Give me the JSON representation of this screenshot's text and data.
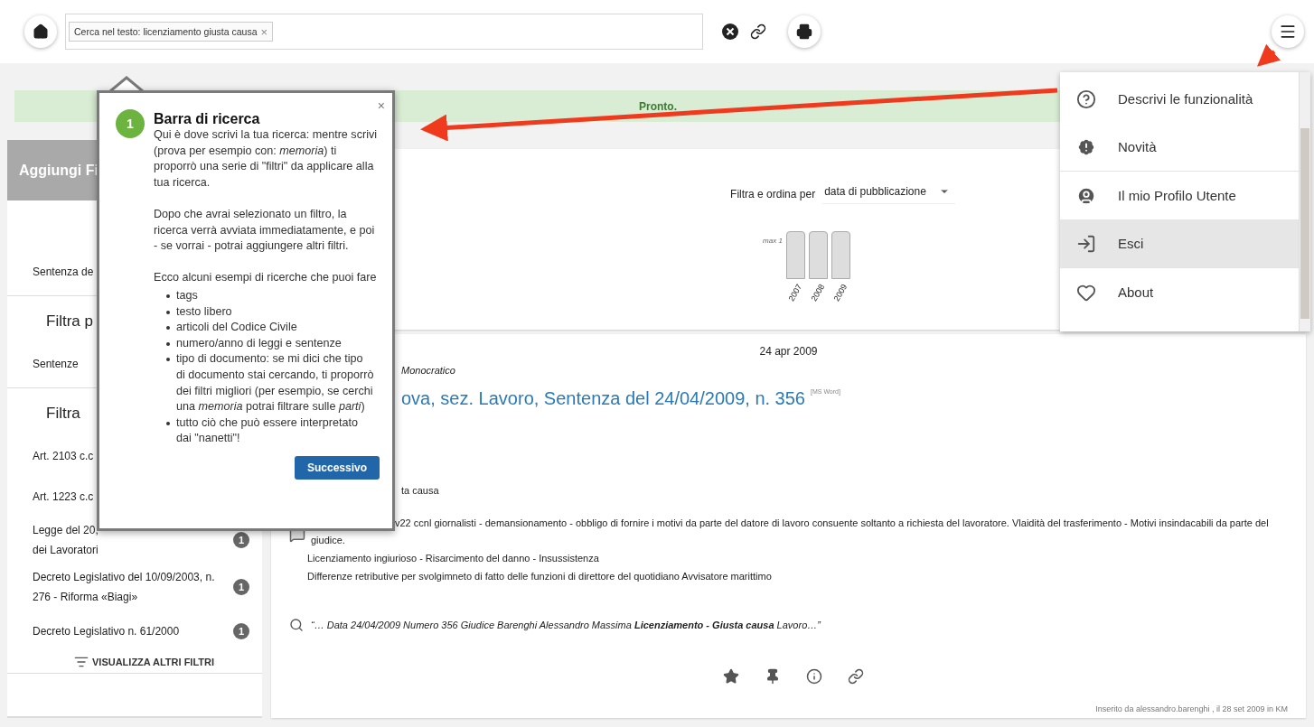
{
  "toolbar": {
    "search_chip": "Cerca nel testo: licenziamento giusta causa",
    "chip_remove": "×"
  },
  "status": {
    "text": "Pronto."
  },
  "sidebar": {
    "add_button": "Aggiungi Fi",
    "sections": [
      {
        "items": [
          {
            "lines": [
              "Sentenza de"
            ]
          }
        ]
      },
      {
        "heading": "Filtra p",
        "items": [
          {
            "lines": [
              "Sentenze"
            ]
          }
        ]
      },
      {
        "heading": "Filtra",
        "items": [
          {
            "lines": [
              "Art. 2103 c.c"
            ]
          },
          {
            "lines": [
              "Art. 1223 c.c"
            ]
          },
          {
            "lines": [
              "Legge del 20,",
              "dei Lavoratori"
            ],
            "count": "1"
          },
          {
            "lines": [
              "Decreto Legislativo del 10/09/2003, n. 276 - Riforma «Biagi»"
            ],
            "count": "1"
          },
          {
            "lines": [
              "Decreto Legislativo n. 61/2000"
            ],
            "count": "1"
          }
        ],
        "more": "VISUALIZZA ALTRI FILTRI"
      }
    ]
  },
  "filter": {
    "label": "Filtra e ordina per",
    "value": "data di pubblicazione"
  },
  "histogram": {
    "max_label": "max 1",
    "years": [
      "2007",
      "2008",
      "2009"
    ]
  },
  "result": {
    "date": "24 apr 2009",
    "court_fragment": "Monocratico",
    "title": "ova, sez. Lavoro, Sentenza del 24/04/2009, n. 356",
    "format": "[MS Word]",
    "tag_fragment": "ta causa",
    "summary_lines": [
      "v22 ccnl giornalisti - demansionamento - obbligo di fornire i motivi da parte del datore di lavoro consuente soltanto a richiesta del lavoratore. Vlaidità del trasferimento - Motivi insindacabili da parte del",
      "giudice."
    ],
    "notes": [
      "Licenziamento ingiurioso - Risarcimento del danno - Insussistenza",
      "Differenze retributive per svolgimneto di fatto delle funzioni di direttore del quotidiano Avvisatore marittimo"
    ],
    "excerpt": "“… Data 24/04/2009 Numero 356 Giudice Barenghi Alessandro Massima **Licenziamento - Giusta causa** Lavoro…”",
    "footer": "Inserito da alessandro.barenghi , il 28 set 2009 in KM"
  },
  "tour": {
    "step": "1",
    "title": "Barra di ricerca",
    "close": "×",
    "paragraphs": [
      "Qui è dove scrivi la tua ricerca: mentre scrivi (prova per esempio con: *memoria*) ti proporrò una serie di \"filtri\" da applicare alla tua ricerca.",
      "Dopo che avrai selezionato un filtro, la ricerca verrà avviata immediatamente, e poi - se vorrai - potrai aggiungere altri filtri.",
      "Ecco alcuni esempi di ricerche che puoi fare"
    ],
    "examples": [
      "tags",
      "testo libero",
      "articoli del Codice Civile",
      "numero/anno di leggi e sentenze",
      "tipo di documento: se mi dici che tipo di documento stai cercando, ti proporrò dei filtri migliori (per esempio, se cerchi una *memoria* potrai filtrare sulle *parti*)",
      "tutto ciò che può essere interpretato dai \"nanetti\"!"
    ],
    "button": "Successivo"
  },
  "menu": {
    "groups": [
      [
        {
          "label": "Descrivi le funzionalità",
          "selected": false
        },
        {
          "label": "Novità",
          "selected": false
        }
      ],
      [
        {
          "label": "Il mio Profilo Utente",
          "selected": false
        },
        {
          "label": "Esci",
          "selected": true
        }
      ],
      [
        {
          "label": "About",
          "selected": false
        }
      ]
    ]
  }
}
